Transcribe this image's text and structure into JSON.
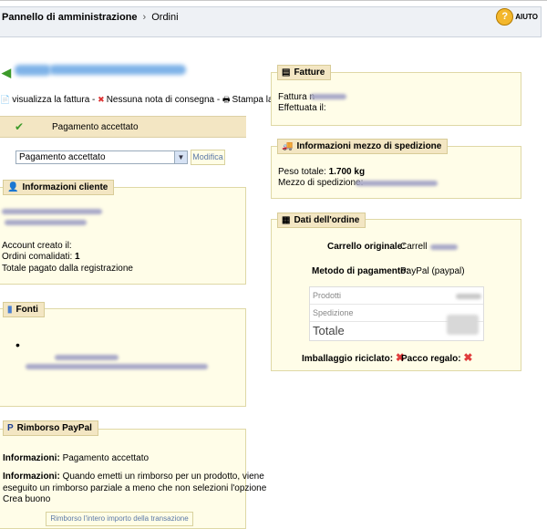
{
  "header": {
    "breadcrumb_root": "Pannello di amministrazione",
    "breadcrumb_current": "Ordini",
    "help_label": "AIUTO"
  },
  "actions": {
    "invoice": "visualizza la fattura",
    "delivery": "Nessuna nota di consegna",
    "print": "Stampa la pagina"
  },
  "status": {
    "current": "Pagamento accettato",
    "select_value": "Pagamento accettato",
    "modify_label": "Modifica"
  },
  "customer": {
    "title": "Informazioni cliente",
    "account_created": "Account creato il:",
    "orders_completed_label": "Ordini comalidati:",
    "orders_completed_value": "1",
    "total_paid": "Totale pagato dalla registrazione"
  },
  "sources": {
    "title": "Fonti",
    "bullet": "•"
  },
  "refund": {
    "title": "Rimborso PayPal",
    "info_label": "Informazioni:",
    "info_value": "Pagamento accettato",
    "info2_label": "Informazioni:",
    "info2_text1": "Quando emetti un rimborso per un prodotto, viene",
    "info2_text2": "eseguito un rimborso parziale a meno che non selezioni l'opzione",
    "info2_text3": "Crea buono",
    "button": "Rimborso l'intero importo della transazione"
  },
  "invoices": {
    "title": "Fatture",
    "invoice_n": "Fattura n",
    "made": "Effettuata il:"
  },
  "shipping": {
    "title": "Informazioni mezzo di spedizione",
    "weight_label": "Peso totale:",
    "weight_value": "1.700 kg",
    "carrier_label": "Mezzo di spedizione:"
  },
  "order": {
    "title": "Dati dell'ordine",
    "cart_label": "Carrello originale:",
    "cart_value": "Carrell",
    "payment_label": "Metodo di pagamento:",
    "payment_value": "PayPal (paypal)",
    "products": "Prodotti",
    "shipping": "Spedizione",
    "total": "Totale",
    "recycled": "Imballaggio riciclato:",
    "gift": "Pacco regalo:"
  }
}
